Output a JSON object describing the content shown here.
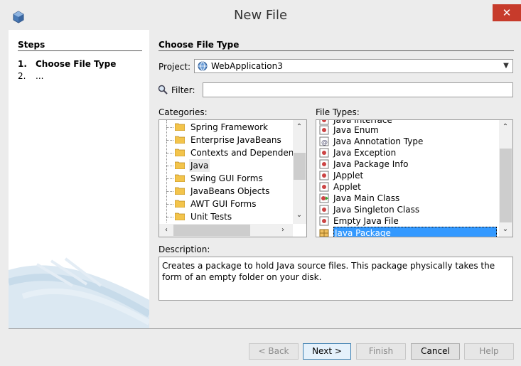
{
  "window": {
    "title": "New File",
    "close_symbol": "✕"
  },
  "steps": {
    "title": "Steps",
    "items": [
      {
        "num": "1.",
        "label": "Choose File Type"
      },
      {
        "num": "2.",
        "label": "..."
      }
    ]
  },
  "main": {
    "title": "Choose File Type",
    "project_label": "Project:",
    "project_value": "WebApplication3",
    "filter_label": "Filter:",
    "filter_value": "",
    "categories_label": "Categories:",
    "file_types_label": "File Types:",
    "description_label": "Description:",
    "description": "Creates a package to hold Java source files. This package physically takes the form of an empty folder on your disk."
  },
  "categories": [
    "Spring Framework",
    "Enterprise JavaBeans",
    "Contexts and Dependency",
    "Java",
    "Swing GUI Forms",
    "JavaBeans Objects",
    "AWT GUI Forms",
    "Unit Tests"
  ],
  "categories_selected": "Java",
  "file_types": [
    "Java Interface",
    "Java Enum",
    "Java Annotation Type",
    "Java Exception",
    "Java Package Info",
    "JApplet",
    "Applet",
    "Java Main Class",
    "Java Singleton Class",
    "Empty Java File",
    "Java Package"
  ],
  "file_types_selected": "Java Package",
  "buttons": {
    "back": "< Back",
    "next": "Next >",
    "finish": "Finish",
    "cancel": "Cancel",
    "help": "Help"
  },
  "colors": {
    "selection": "#3399ff",
    "close": "#c73b2b"
  },
  "icons": {
    "app": "netbeans-cube-icon",
    "project": "globe-icon",
    "filter": "magnifier-icon",
    "folder": "folder-icon"
  }
}
